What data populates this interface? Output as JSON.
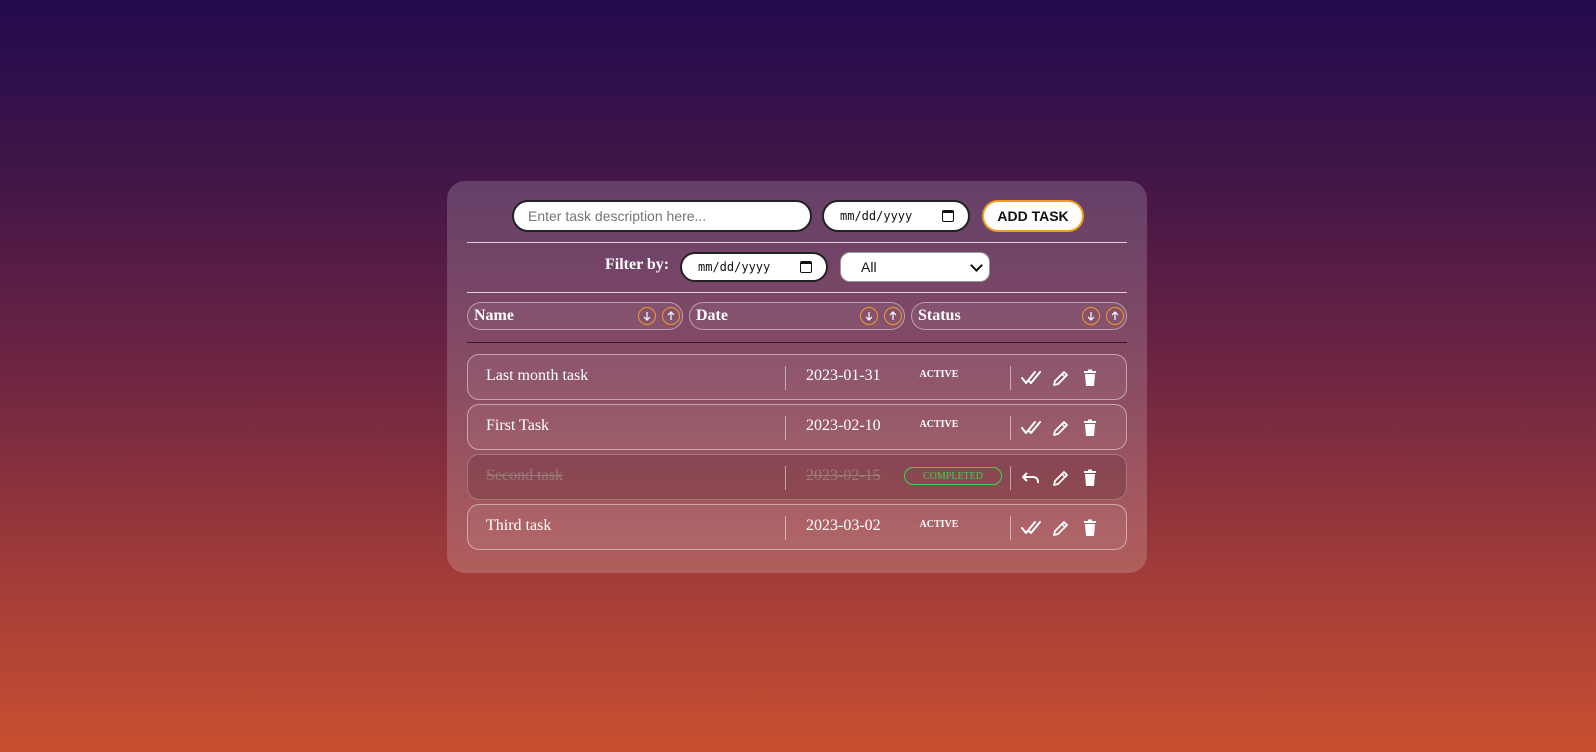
{
  "form": {
    "task_placeholder": "Enter task description here...",
    "date_placeholder": "mm/dd/yyyy",
    "add_button_label": "ADD TASK"
  },
  "filter": {
    "label": "Filter by:",
    "date_placeholder": "mm/dd/yyyy",
    "status_selected": "All"
  },
  "headers": {
    "name": "Name",
    "date": "Date",
    "status": "Status"
  },
  "tasks": [
    {
      "name": "Last month task",
      "date": "2023-01-31",
      "status": "ACTIVE"
    },
    {
      "name": "First Task",
      "date": "2023-02-10",
      "status": "ACTIVE"
    },
    {
      "name": "Second task",
      "date": "2023-02-15",
      "status": "COMPLETED"
    },
    {
      "name": "Third task",
      "date": "2023-03-02",
      "status": "ACTIVE"
    }
  ],
  "colors": {
    "accent": "#f39a1f",
    "completed": "#3bd34a"
  },
  "icons": {
    "sort_desc": "arrow-down-icon",
    "sort_asc": "arrow-up-icon",
    "complete": "double-check-icon",
    "undo": "undo-icon",
    "edit": "pencil-icon",
    "delete": "trash-icon"
  }
}
